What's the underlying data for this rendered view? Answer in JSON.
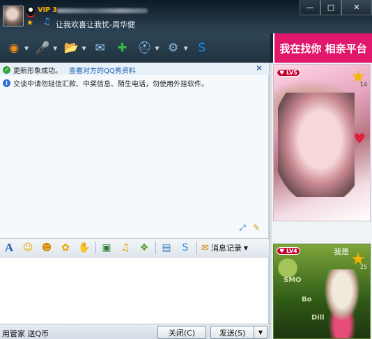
{
  "title_bar": {
    "vip_label": "VIP 3",
    "status_text": "让我欢喜让我忧-周华健",
    "window_buttons": [
      "—",
      "□",
      "✕"
    ]
  },
  "toolbar": {
    "items": [
      {
        "name": "video-chat",
        "icon": "webcam-icon",
        "glyph": "◉",
        "color": "#f08a1b",
        "arrow": true
      },
      {
        "name": "voice-chat",
        "icon": "microphone-icon",
        "glyph": "🎤",
        "color": "#4aa3ff",
        "arrow": true
      },
      {
        "name": "send-file",
        "icon": "folder-send-icon",
        "glyph": "📂",
        "color": "#f0b429",
        "arrow": true
      },
      {
        "name": "send-sms",
        "icon": "sms-icon",
        "glyph": "✉",
        "color": "#9ec9ef",
        "arrow": false
      },
      {
        "name": "create-group",
        "icon": "group-add-icon",
        "glyph": "✚",
        "color": "#3ab54a",
        "arrow": false
      },
      {
        "name": "remote-assist",
        "icon": "remote-icon",
        "glyph": "⛑",
        "color": "#7fb3e6",
        "arrow": true
      },
      {
        "name": "app-settings",
        "icon": "apps-icon",
        "glyph": "⚙",
        "color": "#8fb9e0",
        "arrow": true
      },
      {
        "name": "soso",
        "icon": "soso-icon",
        "glyph": "S",
        "color": "#1e88e5",
        "arrow": false
      }
    ]
  },
  "ad": {
    "banner_text": "我在找你 相亲平台"
  },
  "messages": [
    {
      "type": "ok",
      "text": "更新形象成功。",
      "link": "查看对方的QQ秀资料"
    },
    {
      "type": "info",
      "text": "交谈中请勿轻信汇款、中奖信息、陌生电话，勿使用外挂软件。",
      "link": ""
    }
  ],
  "fmt_toolbar": {
    "icons": [
      {
        "name": "font-icon",
        "glyph": "A",
        "color": "#1c5fb0"
      },
      {
        "name": "emoji-icon",
        "glyph": "☺",
        "color": "#e7a700"
      },
      {
        "name": "magic-emoji-icon",
        "glyph": "☻",
        "color": "#d68a00"
      },
      {
        "name": "sticker-icon",
        "glyph": "✿",
        "color": "#f0a100"
      },
      {
        "name": "nudge-icon",
        "glyph": "✋",
        "color": "#e8a020"
      },
      {
        "name": "image-icon",
        "glyph": "▣",
        "color": "#2f7d3a"
      },
      {
        "name": "music-icon",
        "glyph": "♫",
        "color": "#e5a100"
      },
      {
        "name": "gift-icon",
        "glyph": "❖",
        "color": "#5aa02c"
      },
      {
        "name": "screenshot-icon",
        "glyph": "▤",
        "color": "#3c7cc4"
      },
      {
        "name": "soso-small-icon",
        "glyph": "S",
        "color": "#1e88e5"
      }
    ],
    "message_record_label": "消息记录"
  },
  "qq_show_top": {
    "level": "LV5",
    "star_count": "14"
  },
  "qq_show_bottom": {
    "level": "LV4",
    "label": "我是",
    "star_count": "25",
    "words": [
      "SMO",
      "Bo",
      "Dill"
    ]
  },
  "bottom_bar": {
    "left_text": "用管家 送Q币",
    "close_label": "关闭(C)",
    "send_label": "发送(S)"
  }
}
